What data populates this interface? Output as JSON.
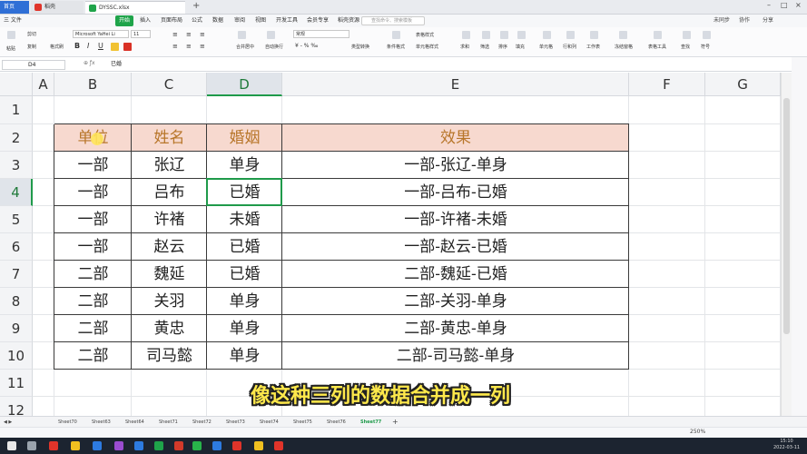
{
  "titlebar": {
    "tabs": [
      "首页",
      "稻壳",
      "DYSSC.xlsx"
    ]
  },
  "menu": {
    "file": "三 文件",
    "items": [
      "开始",
      "插入",
      "页面布局",
      "公式",
      "数据",
      "审阅",
      "视图",
      "开发工具",
      "会员专享",
      "稻壳资源"
    ],
    "search_placeholder": "查找命令、搜索模板",
    "right": [
      "未同步",
      "协作",
      "分享"
    ]
  },
  "ribbon": {
    "paste": "粘贴",
    "cut": "剪切",
    "copy": "复制",
    "format_painter": "格式刷",
    "font": "Microsoft YaHei Li",
    "font_size": "11",
    "number_format": "常规",
    "merge": "合并居中",
    "wrap": "自动换行",
    "type_convert": "类型转换",
    "cond_format": "条件格式",
    "table_style": "表格样式",
    "cell_style": "单元格样式",
    "sum": "求和",
    "filter": "筛选",
    "sort": "排序",
    "fill": "填充",
    "cell": "单元格",
    "row_col": "行和列",
    "worksheet": "工作表",
    "freeze": "冻结窗格",
    "table_tools": "表格工具",
    "find": "查找",
    "symbol": "符号"
  },
  "formula": {
    "cell_ref": "D4",
    "value": "已婚"
  },
  "grid": {
    "columns": [
      "A",
      "B",
      "C",
      "D",
      "E",
      "F",
      "G"
    ],
    "selected_column": "D",
    "rows": [
      "1",
      "2",
      "3",
      "4",
      "5",
      "6",
      "7",
      "8",
      "9",
      "10",
      "11",
      "12"
    ],
    "selected_row": "4",
    "header": [
      "单位",
      "姓名",
      "婚姻",
      "效果"
    ],
    "data": [
      [
        "一部",
        "张辽",
        "单身",
        "一部-张辽-单身"
      ],
      [
        "一部",
        "吕布",
        "已婚",
        "一部-吕布-已婚"
      ],
      [
        "一部",
        "许褚",
        "未婚",
        "一部-许褚-未婚"
      ],
      [
        "一部",
        "赵云",
        "已婚",
        "一部-赵云-已婚"
      ],
      [
        "二部",
        "魏延",
        "已婚",
        "二部-魏延-已婚"
      ],
      [
        "二部",
        "关羽",
        "单身",
        "二部-关羽-单身"
      ],
      [
        "二部",
        "黄忠",
        "单身",
        "二部-黄忠-单身"
      ],
      [
        "二部",
        "司马懿",
        "单身",
        "二部-司马懿-单身"
      ]
    ],
    "header_band_color": "#f7d9cf",
    "header_text_color": "#b8762a",
    "selection_color": "#1f9a4a"
  },
  "subtitle": "像这种三列的数据合并成一列",
  "sheets": [
    "Sheet70",
    "Sheet63",
    "Sheet64",
    "Sheet71",
    "Sheet72",
    "Sheet73",
    "Sheet74",
    "Sheet75",
    "Sheet76",
    "Sheet77"
  ],
  "active_sheet": "Sheet77",
  "status": {
    "zoom": "250%"
  },
  "taskbar": {
    "time": "15:10",
    "date": "2022-03-11"
  }
}
